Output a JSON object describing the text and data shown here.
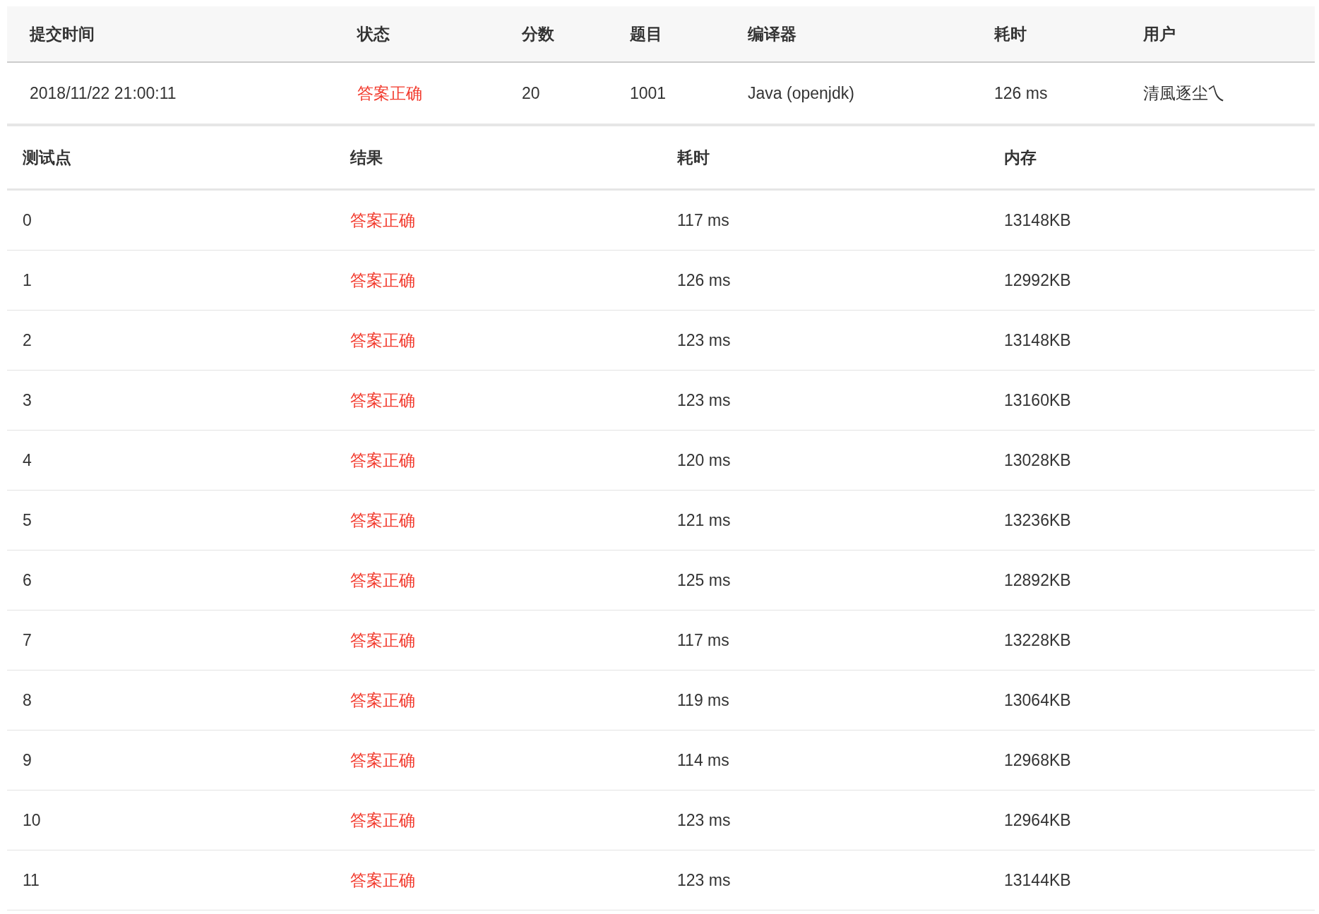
{
  "submission": {
    "columns": [
      "提交时间",
      "状态",
      "分数",
      "题目",
      "编译器",
      "耗时",
      "用户"
    ],
    "row": [
      "2018/11/22 21:00:11",
      "答案正确",
      "20",
      "1001",
      "Java (openjdk)",
      "126 ms",
      "清風逐尘乀"
    ]
  },
  "tests": {
    "columns": [
      "测试点",
      "结果",
      "耗时",
      "内存"
    ],
    "rows": [
      [
        "0",
        "答案正确",
        "117 ms",
        "13148KB"
      ],
      [
        "1",
        "答案正确",
        "126 ms",
        "12992KB"
      ],
      [
        "2",
        "答案正确",
        "123 ms",
        "13148KB"
      ],
      [
        "3",
        "答案正确",
        "123 ms",
        "13160KB"
      ],
      [
        "4",
        "答案正确",
        "120 ms",
        "13028KB"
      ],
      [
        "5",
        "答案正确",
        "121 ms",
        "13236KB"
      ],
      [
        "6",
        "答案正确",
        "125 ms",
        "12892KB"
      ],
      [
        "7",
        "答案正确",
        "117 ms",
        "13228KB"
      ],
      [
        "8",
        "答案正确",
        "119 ms",
        "13064KB"
      ],
      [
        "9",
        "答案正确",
        "114 ms",
        "12968KB"
      ],
      [
        "10",
        "答案正确",
        "123 ms",
        "12964KB"
      ],
      [
        "11",
        "答案正确",
        "123 ms",
        "13144KB"
      ]
    ]
  }
}
